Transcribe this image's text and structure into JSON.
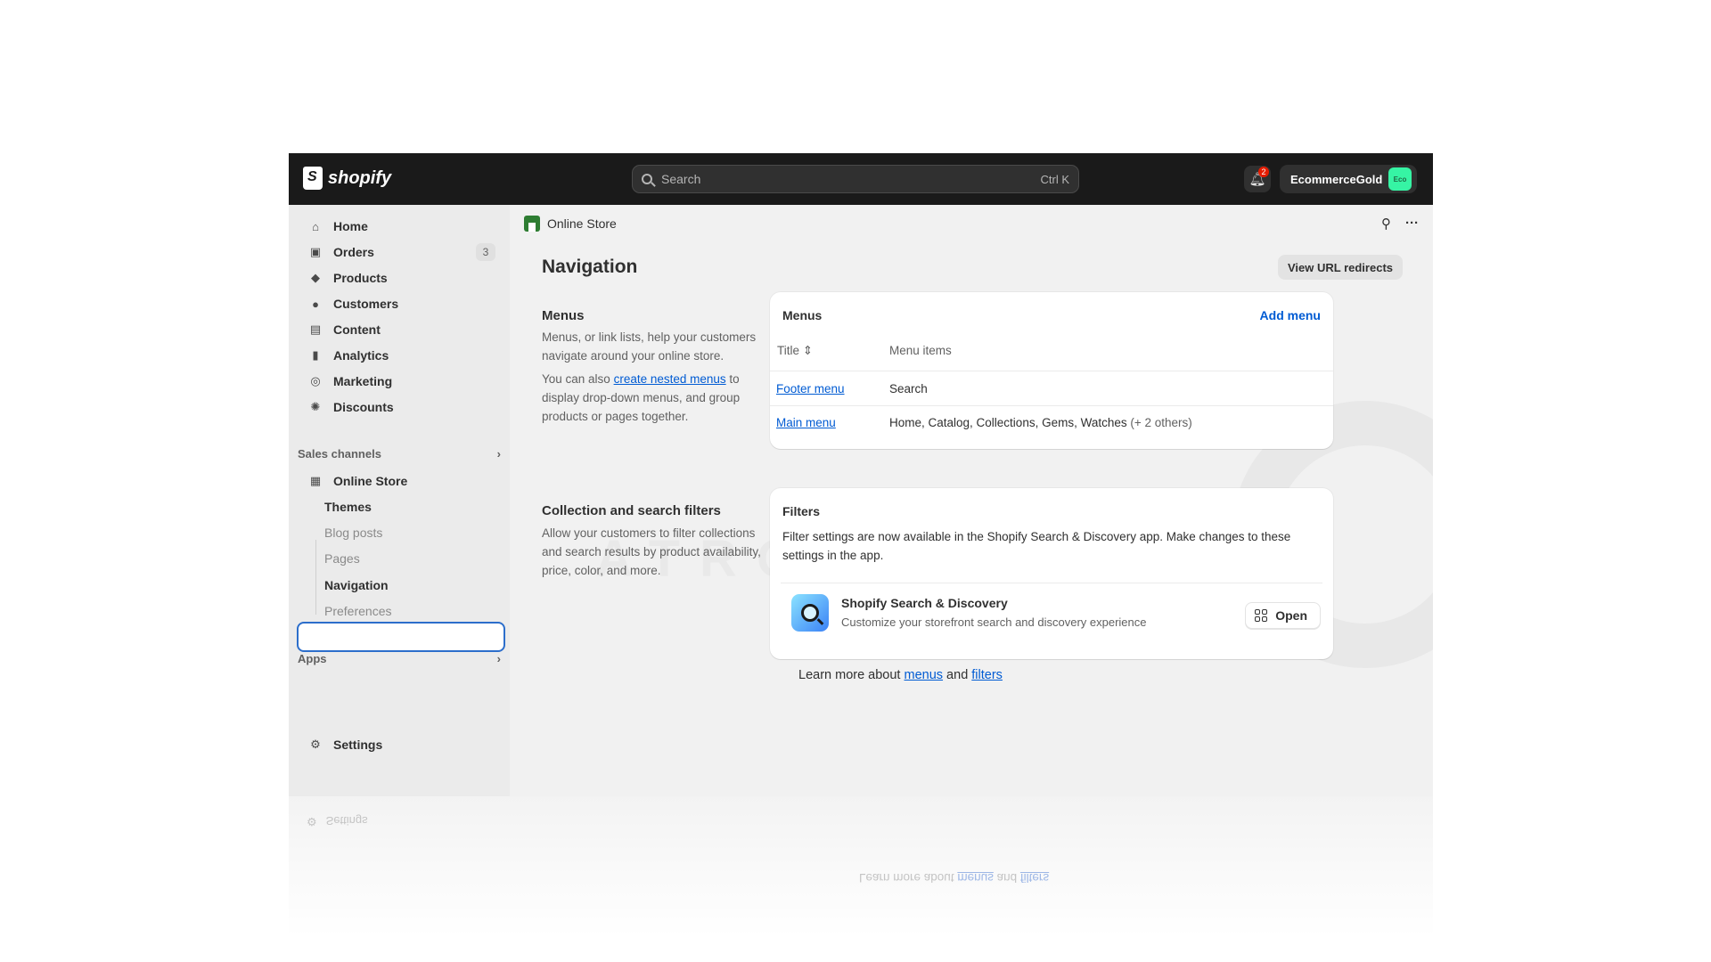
{
  "topbar": {
    "logo_text": "shopify",
    "search_placeholder": "Search",
    "search_shortcut": "Ctrl K",
    "notification_count": "2",
    "store_name": "EcommerceGold",
    "avatar_text": "Eco"
  },
  "sidebar": {
    "items": [
      {
        "label": "Home",
        "icon": "home-icon"
      },
      {
        "label": "Orders",
        "icon": "inbox-icon",
        "badge": "3"
      },
      {
        "label": "Products",
        "icon": "tag-icon"
      },
      {
        "label": "Customers",
        "icon": "person-icon"
      },
      {
        "label": "Content",
        "icon": "content-icon"
      },
      {
        "label": "Analytics",
        "icon": "bar-chart-icon"
      },
      {
        "label": "Marketing",
        "icon": "target-icon"
      },
      {
        "label": "Discounts",
        "icon": "discount-icon"
      }
    ],
    "sales_channels_label": "Sales channels",
    "online_store_label": "Online Store",
    "sub_items": [
      "Themes",
      "Blog posts",
      "Pages",
      "Navigation",
      "Preferences"
    ],
    "apps_label": "Apps",
    "settings_label": "Settings"
  },
  "main": {
    "breadcrumb": "Online Store",
    "page_title": "Navigation",
    "url_redirects_button": "View URL redirects",
    "menus_section": {
      "title": "Menus",
      "desc1": "Menus, or link lists, help your customers navigate around your online store.",
      "desc2_prefix": "You can also ",
      "desc2_link": "create nested menus",
      "desc2_suffix": " to display drop-down menus, and group products or pages together."
    },
    "menus_card": {
      "title": "Menus",
      "add_menu": "Add menu",
      "col_title": "Title",
      "col_items": "Menu items",
      "rows": [
        {
          "title": "Footer menu",
          "items": "Search",
          "extra": ""
        },
        {
          "title": "Main menu",
          "items": "Home, Catalog, Collections, Gems, Watches",
          "extra": "(+ 2 others)"
        }
      ]
    },
    "filters_section": {
      "title": "Collection and search filters",
      "desc": "Allow your customers to filter collections and search results by product availability, price, color, and more."
    },
    "filters_card": {
      "title": "Filters",
      "text": "Filter settings are now available in the Shopify Search & Discovery app. Make changes to these settings in the app.",
      "app_name": "Shopify Search & Discovery",
      "app_desc": "Customize your storefront search and discovery experience",
      "open_label": "Open"
    },
    "learn_more": {
      "prefix": "Learn more about ",
      "link1": "menus",
      "mid": " and ",
      "link2": "filters"
    }
  },
  "watermark_text": "ATRO ACADEMY"
}
